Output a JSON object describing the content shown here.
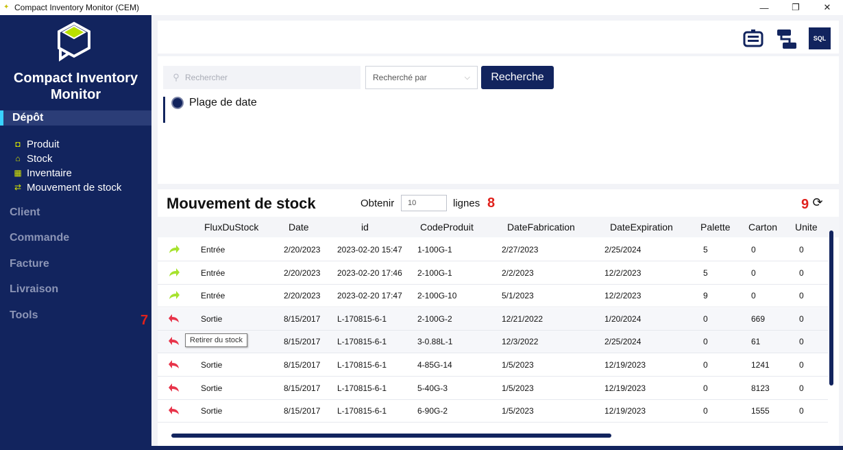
{
  "window": {
    "title": "Compact Inventory Monitor (CEM)",
    "minimize": "—",
    "maximize": "❐",
    "close": "✕"
  },
  "sidebar": {
    "brand_line1": "Compact Inventory",
    "brand_line2": "Monitor",
    "active_section": "Dépôt",
    "sub_items": [
      {
        "label": "Produit",
        "icon": "box-icon"
      },
      {
        "label": "Stock",
        "icon": "warehouse-icon"
      },
      {
        "label": "Inventaire",
        "icon": "inventory-icon"
      },
      {
        "label": "Mouvement de stock",
        "icon": "swap-arrows-icon"
      }
    ],
    "sections": [
      "Client",
      "Commande",
      "Facture",
      "Livraison",
      "Tools"
    ]
  },
  "topbar": {
    "sql_label": "SQL"
  },
  "filter": {
    "search_placeholder": "Rechercher",
    "search_by": "Recherché par",
    "search_button": "Recherche",
    "date_range_label": "Plage de date"
  },
  "panel": {
    "title": "Mouvement de stock",
    "get_label": "Obtenir",
    "row_count": "10",
    "rows_label": "lignes",
    "annotation_7": "7",
    "annotation_8": "8",
    "annotation_9": "9",
    "tooltip": "Retirer du stock",
    "columns": [
      "FluxDuStock",
      "Date",
      "id",
      "CodeProduit",
      "DateFabrication",
      "DateExpiration",
      "Palette",
      "Carton",
      "Unite"
    ],
    "rows": [
      {
        "type": "in",
        "flux": "Entrée",
        "date": "2/20/2023",
        "id": "2023-02-20 15:47",
        "code": "1-100G-1",
        "fab": "2/27/2023",
        "exp": "2/25/2024",
        "palette": "5",
        "carton": "0",
        "unite": "0"
      },
      {
        "type": "in",
        "flux": "Entrée",
        "date": "2/20/2023",
        "id": "2023-02-20 17:46",
        "code": "2-100G-1",
        "fab": "2/2/2023",
        "exp": "12/2/2023",
        "palette": "5",
        "carton": "0",
        "unite": "0"
      },
      {
        "type": "in",
        "flux": "Entrée",
        "date": "2/20/2023",
        "id": "2023-02-20 17:47",
        "code": "2-100G-10",
        "fab": "5/1/2023",
        "exp": "12/2/2023",
        "palette": "9",
        "carton": "0",
        "unite": "0"
      },
      {
        "type": "out",
        "flux": "Sortie",
        "date": "8/15/2017",
        "id": "L-170815-6-1",
        "code": "2-100G-2",
        "fab": "12/21/2022",
        "exp": "1/20/2024",
        "palette": "0",
        "carton": "669",
        "unite": "0"
      },
      {
        "type": "out",
        "flux": "",
        "date": "8/15/2017",
        "id": "L-170815-6-1",
        "code": "3-0.88L-1",
        "fab": "12/3/2022",
        "exp": "2/25/2024",
        "palette": "0",
        "carton": "61",
        "unite": "0"
      },
      {
        "type": "out",
        "flux": "Sortie",
        "date": "8/15/2017",
        "id": "L-170815-6-1",
        "code": "4-85G-14",
        "fab": "1/5/2023",
        "exp": "12/19/2023",
        "palette": "0",
        "carton": "1241",
        "unite": "0"
      },
      {
        "type": "out",
        "flux": "Sortie",
        "date": "8/15/2017",
        "id": "L-170815-6-1",
        "code": "5-40G-3",
        "fab": "1/5/2023",
        "exp": "12/19/2023",
        "palette": "0",
        "carton": "8123",
        "unite": "0"
      },
      {
        "type": "out",
        "flux": "Sortie",
        "date": "8/15/2017",
        "id": "L-170815-6-1",
        "code": "6-90G-2",
        "fab": "1/5/2023",
        "exp": "12/19/2023",
        "palette": "0",
        "carton": "1555",
        "unite": "0"
      }
    ]
  },
  "colors": {
    "navy": "#12245e",
    "accent_cyan": "#39d3ff",
    "icon_yellow": "#d4e400",
    "in_green": "#a6e22e",
    "out_red": "#e8344a",
    "annotation_red": "#e0211c"
  }
}
